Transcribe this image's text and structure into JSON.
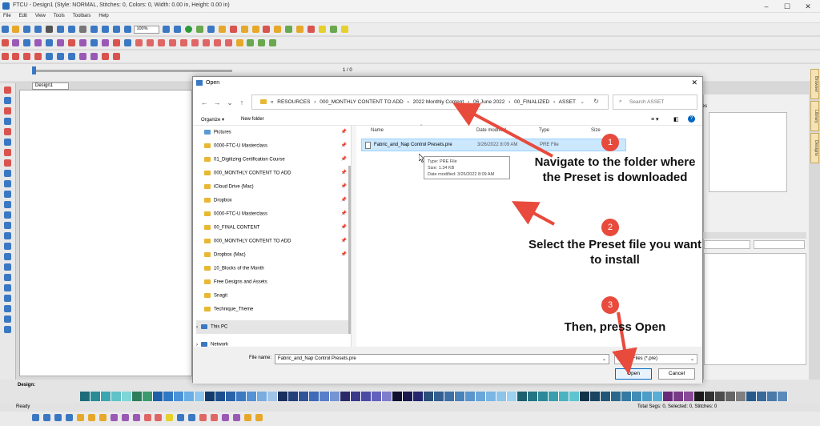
{
  "app": {
    "title": "FTCU - Design1 (Style: NORMAL, Stitches: 0, Colors: 0, Width: 0.00 in, Height: 0.00 in)",
    "menu": [
      "File",
      "Edit",
      "View",
      "Tools",
      "Toolbars",
      "Help"
    ],
    "zoom": "100%",
    "page_counter": "1 / 0",
    "document_tab": "Design1",
    "design_label": "Design:",
    "side_tabs": [
      "Browser",
      "Library",
      "Designs"
    ],
    "right_panel_label": "tes",
    "status_left": "Ready",
    "status_right": "Total Segs: 0, Selected: 0, Stitches: 0"
  },
  "dialog": {
    "title": "Open",
    "breadcrumb": [
      "«",
      "RESOURCES",
      "›",
      "000_MONTHLY CONTENT TO ADD",
      "›",
      "2022 Monthly Content",
      "›",
      "06 June 2022",
      "›",
      "00_FINALIZED",
      "›",
      "ASSET"
    ],
    "search_placeholder": "Search ASSET",
    "organize_label": "Organize ▾",
    "new_folder_label": "New folder",
    "nav_items": [
      {
        "label": "Pictures",
        "pinned": true
      },
      {
        "label": "0000-FTC-U Masterclass",
        "pinned": true
      },
      {
        "label": "01_Digitizing Certification Course",
        "pinned": true
      },
      {
        "label": "000_MONTHLY CONTENT TO ADD",
        "pinned": true
      },
      {
        "label": "iCloud Drive (Mac)",
        "pinned": true
      },
      {
        "label": "Dropbox",
        "pinned": true
      },
      {
        "label": "0000-FTC-U Masterclass",
        "pinned": true
      },
      {
        "label": "00_FINAL CONTENT",
        "pinned": true
      },
      {
        "label": "000_MONTHLY CONTENT TO ADD",
        "pinned": true
      },
      {
        "label": "Dropbox (Mac)",
        "pinned": true
      },
      {
        "label": "10_Blocks of the Month",
        "pinned": false
      },
      {
        "label": "Free Designs and Assets",
        "pinned": false
      },
      {
        "label": "Snagit",
        "pinned": false
      },
      {
        "label": "Technique_Theme",
        "pinned": false
      }
    ],
    "this_pc": "This PC",
    "network": "Network",
    "columns": [
      "Name",
      "Date modified",
      "Type",
      "Size"
    ],
    "file": {
      "name": "Fabric_and_Nap Control Presets.pre",
      "date": "3/26/2022 8:09 AM",
      "type": "PRE File"
    },
    "tooltip": {
      "type": "Type: PRE File",
      "size": "Size: 1.34 KB",
      "date": "Date modified: 3/26/2022 8:09 AM"
    },
    "filename_label": "File name:",
    "filename_value": "Fabric_and_Nap Control Presets.pre",
    "filetype": "Preset Files (*.pre)",
    "open_label": "Open",
    "cancel_label": "Cancel"
  },
  "annotations": [
    {
      "number": "1",
      "text": "Navigate to the folder where the Preset is downloaded"
    },
    {
      "number": "2",
      "text": "Select the Preset file you want to install"
    },
    {
      "number": "3",
      "text": "Then, press Open"
    }
  ],
  "colors": {
    "accent": "#e84a3c",
    "folder": "#e8b832",
    "selection": "#cce8ff"
  }
}
